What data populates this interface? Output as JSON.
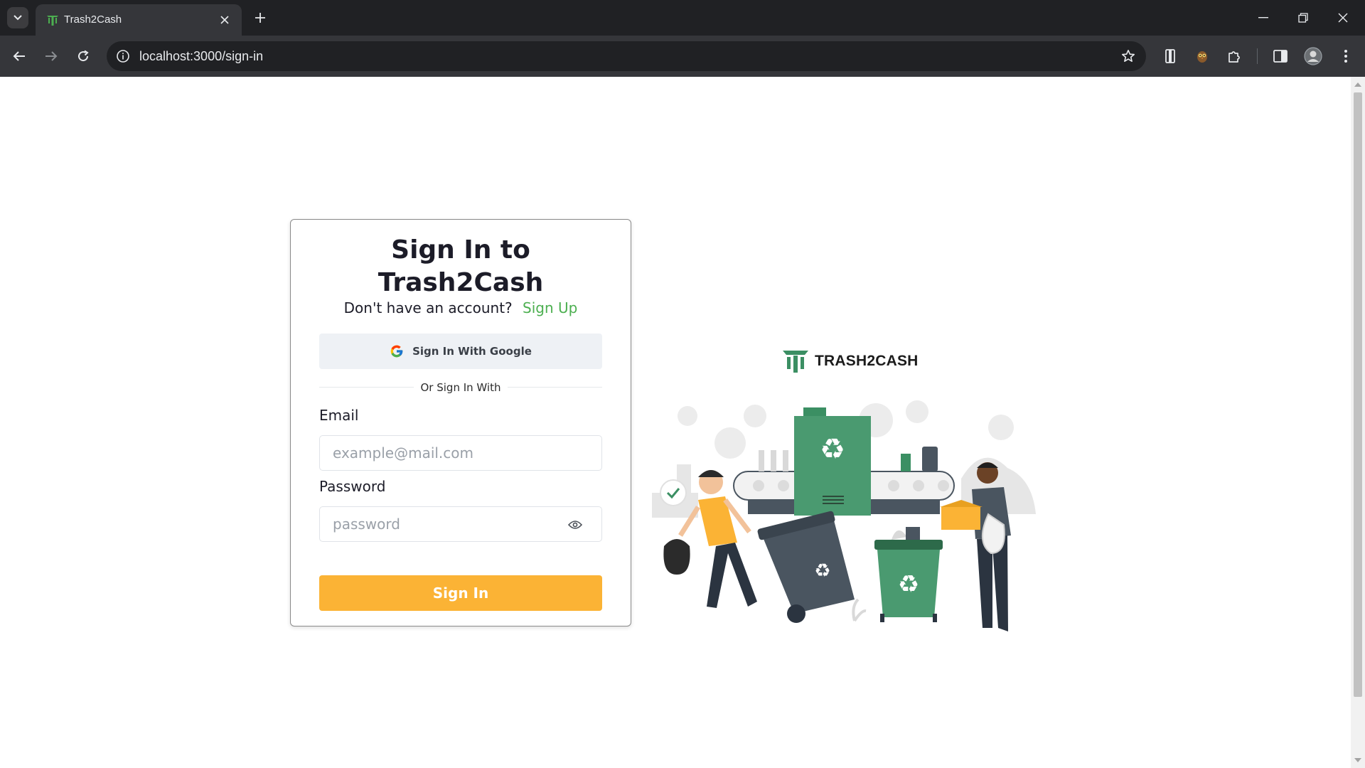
{
  "browser": {
    "tab_title": "Trash2Cash",
    "url": "localhost:3000/sign-in"
  },
  "page": {
    "title": "Sign In to Trash2Cash",
    "no_account_text": "Don't have an account?",
    "signup_link": "Sign Up",
    "google_button": "Sign In With Google",
    "divider_text": "Or Sign In With",
    "email_label": "Email",
    "email_placeholder": "example@mail.com",
    "password_label": "Password",
    "password_placeholder": "password",
    "signin_button": "Sign In",
    "brand_name": "TRASH2CASH"
  },
  "colors": {
    "accent_green": "#4caf50",
    "brand_green": "#3b8f63",
    "button_yellow": "#fbb335",
    "chrome_dark": "#202124"
  },
  "icons": [
    "tab-search-icon",
    "close-icon",
    "plus-icon",
    "minimize-icon",
    "restore-icon",
    "back-icon",
    "forward-icon",
    "reload-icon",
    "info-icon",
    "star-icon",
    "reading-mode-icon",
    "extension-icon",
    "puzzle-icon",
    "side-panel-icon",
    "profile-icon",
    "menu-icon",
    "google-icon",
    "eye-icon",
    "trash2cash-logo"
  ]
}
